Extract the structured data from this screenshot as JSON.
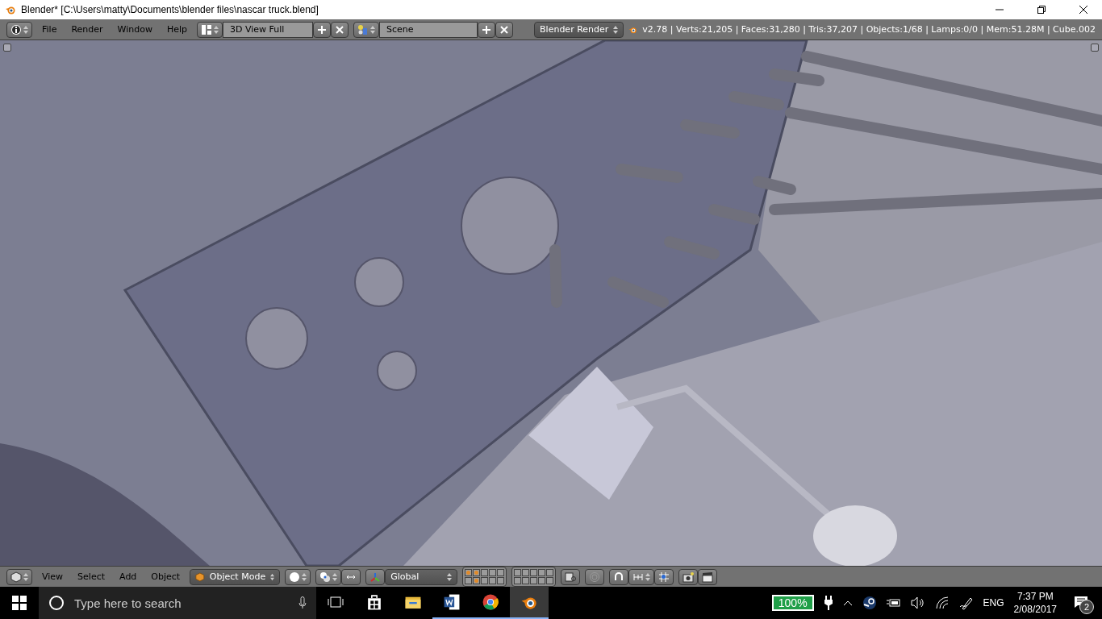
{
  "window": {
    "title": "Blender* [C:\\Users\\matty\\Documents\\blender files\\nascar truck.blend]"
  },
  "info_header": {
    "menus": [
      "File",
      "Render",
      "Window",
      "Help"
    ],
    "screen_layout": "3D View Full",
    "scene": "Scene",
    "render_engine": "Blender Render",
    "stats": "v2.78 | Verts:21,205 | Faces:31,280 | Tris:37,207 | Objects:1/68 | Lamps:0/0 | Mem:51.28M | Cube.002"
  },
  "view3d_header": {
    "menus": [
      "View",
      "Select",
      "Add",
      "Object"
    ],
    "mode": "Object Mode",
    "orientation": "Global",
    "layers": [
      {
        "used": true
      },
      {
        "used": true
      },
      {
        "used": false
      },
      {
        "used": false
      },
      {
        "used": false
      },
      {
        "used": false
      },
      {
        "used": true
      },
      {
        "used": false
      },
      {
        "used": false
      },
      {
        "used": false
      },
      {
        "used": false
      },
      {
        "used": false
      },
      {
        "used": false
      },
      {
        "used": false
      },
      {
        "used": false
      },
      {
        "used": false
      },
      {
        "used": false
      },
      {
        "used": false
      },
      {
        "used": false
      },
      {
        "used": false
      }
    ]
  },
  "taskbar": {
    "search": {
      "placeholder": "Type here to search"
    },
    "apps": [
      {
        "kind": "store",
        "running": false,
        "selected": false
      },
      {
        "kind": "explorer",
        "running": false,
        "selected": false
      },
      {
        "kind": "word",
        "running": true,
        "selected": false
      },
      {
        "kind": "chrome",
        "running": true,
        "selected": false
      },
      {
        "kind": "blender",
        "running": true,
        "selected": true
      }
    ],
    "battery": "100%",
    "language": "ENG",
    "time": "7:37 PM",
    "date": "2/08/2017",
    "notifications": "2"
  }
}
